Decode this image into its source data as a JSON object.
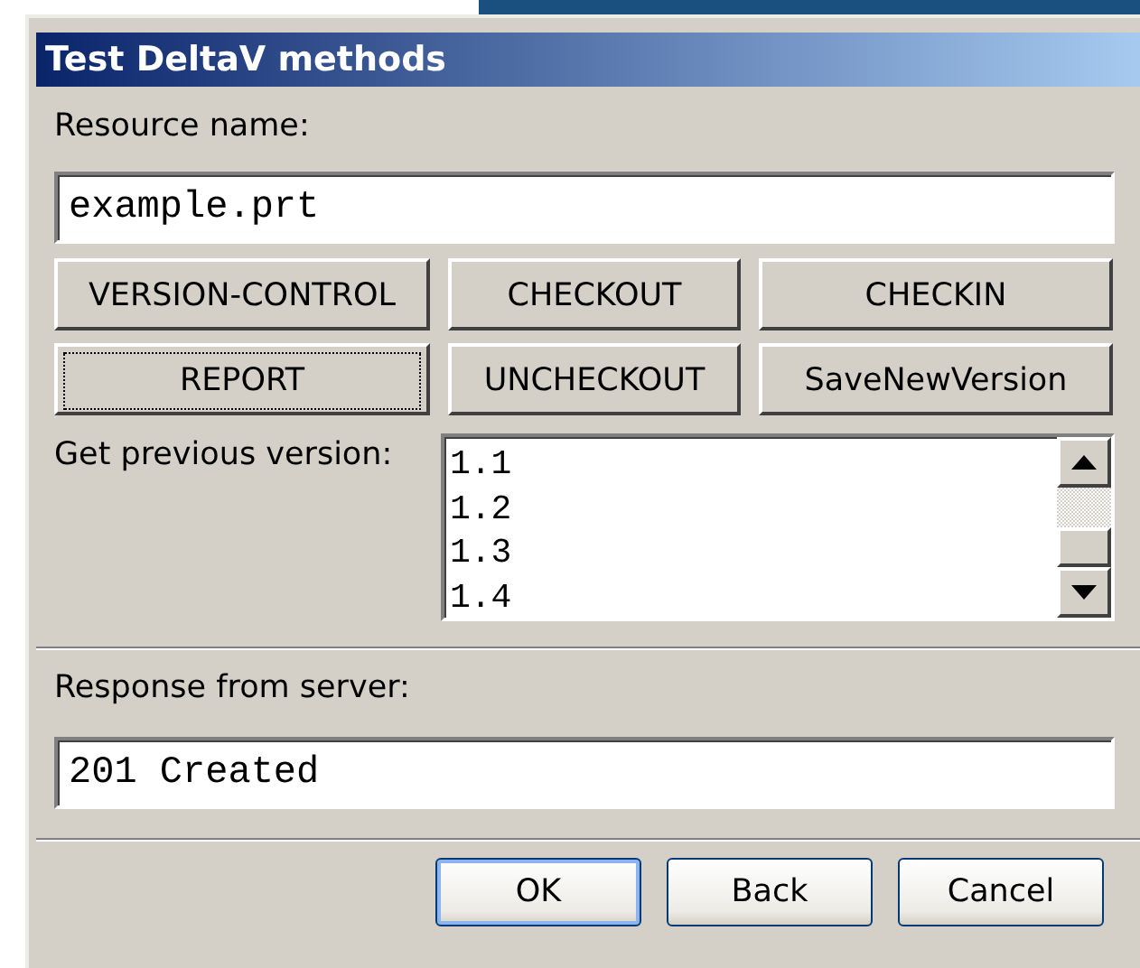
{
  "window": {
    "title": "Test DeltaV methods"
  },
  "resource": {
    "label": "Resource name:",
    "value": "example.prt"
  },
  "actions": [
    {
      "label": "VERSION-CONTROL",
      "focused": false
    },
    {
      "label": "CHECKOUT",
      "focused": false
    },
    {
      "label": "CHECKIN",
      "focused": false
    },
    {
      "label": "REPORT",
      "focused": true
    },
    {
      "label": "UNCHECKOUT",
      "focused": false
    },
    {
      "label": "SaveNewVersion",
      "focused": false
    }
  ],
  "versions": {
    "label": "Get previous version:",
    "items": [
      {
        "label": "1.1",
        "selected": false
      },
      {
        "label": "1.2",
        "selected": false
      },
      {
        "label": "1.3",
        "selected": false
      },
      {
        "label": "1.4",
        "selected": false
      }
    ]
  },
  "response": {
    "label": "Response from server:",
    "value": "201 Created"
  },
  "buttons": [
    {
      "label": "OK",
      "default": true
    },
    {
      "label": "Back",
      "default": false
    },
    {
      "label": "Cancel",
      "default": false
    }
  ]
}
